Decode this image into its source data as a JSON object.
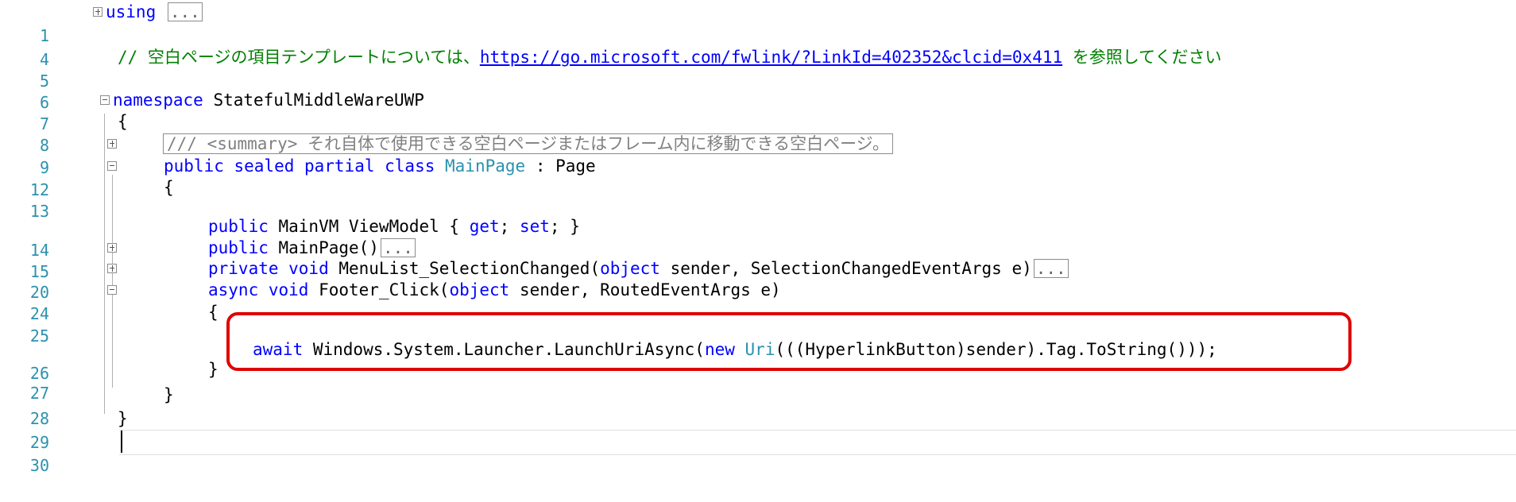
{
  "line_numbers": [
    "1",
    "4",
    "5",
    "6",
    "7",
    "8",
    "9",
    "12",
    "13",
    "14",
    "15",
    "20",
    "24",
    "25",
    "26",
    "27",
    "28",
    "29",
    "30"
  ],
  "code": {
    "l1_kw": "using",
    "l1_collapsed": "...",
    "l5_comment_prefix": "// 空白ページの項目テンプレートについては、",
    "l5_link": "https://go.microsoft.com/fwlink/?LinkId=402352&clcid=0x411",
    "l5_comment_suffix": " を参照してください",
    "l7_kw": "namespace",
    "l7_name": " StatefulMiddleWareUWP",
    "l8": "{",
    "l9_summary": "/// <summary> それ自体で使用できる空白ページまたはフレーム内に移動できる空白ページ。",
    "l12_kw": "public sealed partial class",
    "l12_type": " MainPage",
    "l12_rest": " : Page",
    "l13": "{",
    "l14_kw1": "public",
    "l14_mid": " MainVM ViewModel { ",
    "l14_kw2": "get",
    "l14_sep": "; ",
    "l14_kw3": "set",
    "l14_end": "; }",
    "l15_kw": "public",
    "l15_rest": " MainPage()",
    "l15_collapsed": "...",
    "l20_kw": "private void",
    "l20_rest": " MenuList_SelectionChanged(",
    "l20_kw2": "object",
    "l20_rest2": " sender, SelectionChangedEventArgs e)",
    "l20_collapsed": "...",
    "l24_kw": "async void",
    "l24_rest": " Footer_Click(",
    "l24_kw2": "object",
    "l24_rest2": " sender, RoutedEventArgs e)",
    "l25": "{",
    "l26_kw": "await",
    "l26_rest": " Windows.System.Launcher.LaunchUriAsync(",
    "l26_kw2": "new",
    "l26_type": " Uri",
    "l26_rest2": "(((HyperlinkButton)sender).Tag.ToString()));",
    "l27": "}",
    "l28": "}",
    "l29": "}"
  },
  "colors": {
    "keyword": "#0000ff",
    "type": "#2b91af",
    "comment": "#008000",
    "highlight_border": "#e00000"
  }
}
